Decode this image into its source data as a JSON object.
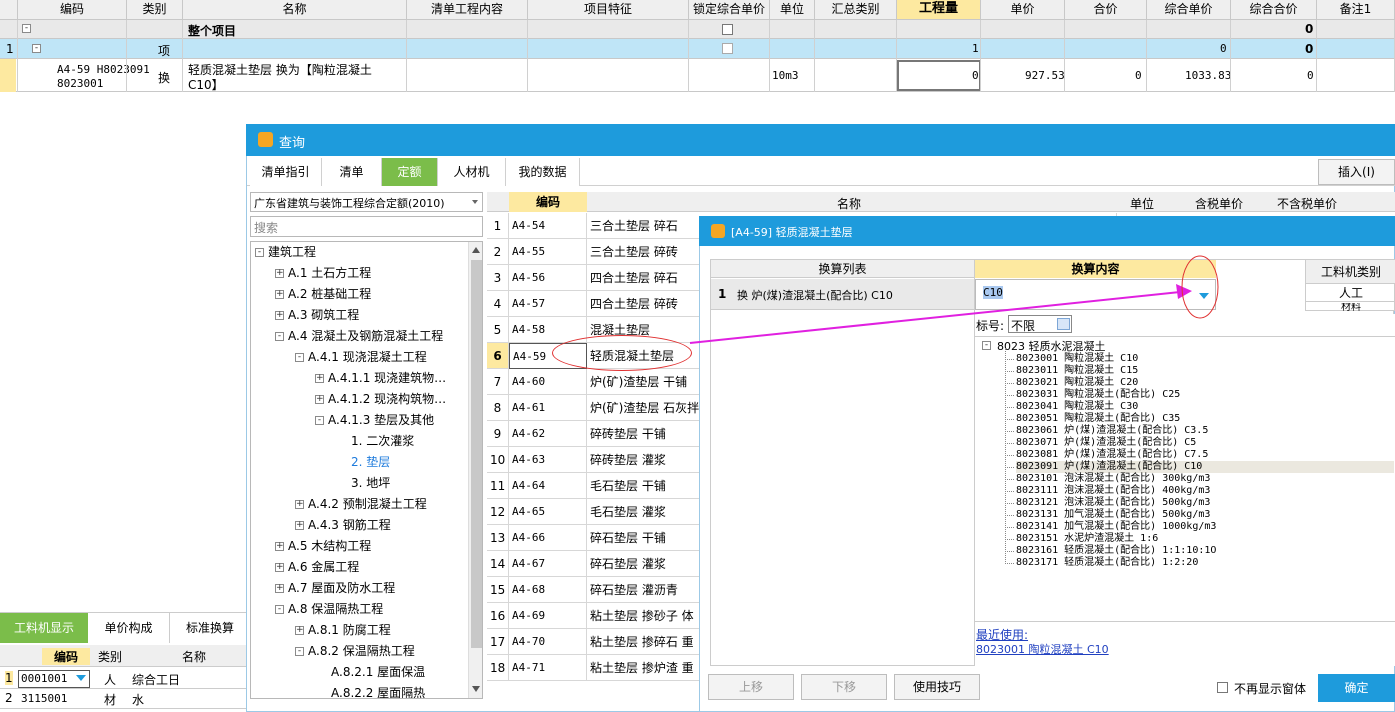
{
  "main_grid": {
    "headers": [
      "编码",
      "类别",
      "名称",
      "清单工程内容",
      "项目特征",
      "锁定综合单价",
      "单位",
      "汇总类别",
      "工程量",
      "单价",
      "合价",
      "综合单价",
      "综合合价",
      "备注1"
    ],
    "row0": {
      "name": "整个项目",
      "total": "0"
    },
    "row1": {
      "num": "1",
      "type": "项",
      "qty": "1",
      "total_unit": "0",
      "total": "0"
    },
    "row2": {
      "code_line1": "A4-59 H8023091",
      "code_line2": "8023001",
      "type": "换",
      "name_line1": "轻质混凝土垫层  换为【陶粒混凝土",
      "name_line2": "C10】",
      "unit": "10m3",
      "qty": "0",
      "price": "927.53",
      "amount": "0",
      "unit_total": "1033.83",
      "total": "0"
    }
  },
  "query_dialog": {
    "title": "查询",
    "tabs": [
      "清单指引",
      "清单",
      "定额",
      "人材机",
      "我的数据"
    ],
    "active_tab": "定额",
    "insert_button": "插入(I)",
    "norm_select": "广东省建筑与装饰工程综合定额(2010)",
    "search_placeholder": "搜索",
    "tree": [
      {
        "label": "建筑工程",
        "level": 0,
        "pm": "-"
      },
      {
        "label": "A.1 土石方工程",
        "level": 1,
        "pm": "+"
      },
      {
        "label": "A.2 桩基础工程",
        "level": 1,
        "pm": "+"
      },
      {
        "label": "A.3 砌筑工程",
        "level": 1,
        "pm": "+"
      },
      {
        "label": "A.4 混凝土及钢筋混凝土工程",
        "level": 1,
        "pm": "-"
      },
      {
        "label": "A.4.1 现浇混凝土工程",
        "level": 2,
        "pm": "-"
      },
      {
        "label": "A.4.1.1 现浇建筑物…",
        "level": 3,
        "pm": "+"
      },
      {
        "label": "A.4.1.2 现浇构筑物…",
        "level": 3,
        "pm": "+"
      },
      {
        "label": "A.4.1.3 垫层及其他",
        "level": 3,
        "pm": "-"
      },
      {
        "label": "1. 二次灌浆",
        "level": 4,
        "pm": ""
      },
      {
        "label": "2. 垫层",
        "level": 4,
        "pm": "",
        "selected": true
      },
      {
        "label": "3. 地坪",
        "level": 4,
        "pm": ""
      },
      {
        "label": "A.4.2 预制混凝土工程",
        "level": 2,
        "pm": "+"
      },
      {
        "label": "A.4.3 钢筋工程",
        "level": 2,
        "pm": "+"
      },
      {
        "label": "A.5 木结构工程",
        "level": 1,
        "pm": "+"
      },
      {
        "label": "A.6 金属工程",
        "level": 1,
        "pm": "+"
      },
      {
        "label": "A.7 屋面及防水工程",
        "level": 1,
        "pm": "+"
      },
      {
        "label": "A.8 保温隔热工程",
        "level": 1,
        "pm": "-"
      },
      {
        "label": "A.8.1 防腐工程",
        "level": 2,
        "pm": "+"
      },
      {
        "label": "A.8.2 保温隔热工程",
        "level": 2,
        "pm": "-"
      },
      {
        "label": "A.8.2.1 屋面保温",
        "level": 3,
        "pm": ""
      },
      {
        "label": "A.8.2.2 屋面隔热",
        "level": 3,
        "pm": ""
      }
    ],
    "list_headers": [
      "编码",
      "名称",
      "单位",
      "含税单价",
      "不含税单价"
    ],
    "list_rows": [
      {
        "n": "1",
        "code": "A4-54",
        "name": "三合土垫层 碎石"
      },
      {
        "n": "2",
        "code": "A4-55",
        "name": "三合土垫层 碎砖"
      },
      {
        "n": "3",
        "code": "A4-56",
        "name": "四合土垫层 碎石"
      },
      {
        "n": "4",
        "code": "A4-57",
        "name": "四合土垫层 碎砖"
      },
      {
        "n": "5",
        "code": "A4-58",
        "name": "混凝土垫层"
      },
      {
        "n": "6",
        "code": "A4-59",
        "name": "轻质混凝土垫层"
      },
      {
        "n": "7",
        "code": "A4-60",
        "name": "炉(矿)渣垫层 干铺"
      },
      {
        "n": "8",
        "code": "A4-61",
        "name": "炉(矿)渣垫层 石灰拌"
      },
      {
        "n": "9",
        "code": "A4-62",
        "name": "碎砖垫层 干铺"
      },
      {
        "n": "10",
        "code": "A4-63",
        "name": "碎砖垫层 灌浆"
      },
      {
        "n": "11",
        "code": "A4-64",
        "name": "毛石垫层 干铺"
      },
      {
        "n": "12",
        "code": "A4-65",
        "name": "毛石垫层 灌浆"
      },
      {
        "n": "13",
        "code": "A4-66",
        "name": "碎石垫层 干铺"
      },
      {
        "n": "14",
        "code": "A4-67",
        "name": "碎石垫层 灌浆"
      },
      {
        "n": "15",
        "code": "A4-68",
        "name": "碎石垫层 灌沥青"
      },
      {
        "n": "16",
        "code": "A4-69",
        "name": "粘土垫层 掺砂子 体"
      },
      {
        "n": "17",
        "code": "A4-70",
        "name": "粘土垫层 掺碎石 重"
      },
      {
        "n": "18",
        "code": "A4-71",
        "name": "粘土垫层 掺炉渣 重"
      }
    ]
  },
  "conv_dialog": {
    "title": "[A4-59] 轻质混凝土垫层",
    "list_header": "换算列表",
    "content_header": "换算内容",
    "row_num": "1",
    "row_label": "换 炉(煤)渣混凝土(配合比) C10",
    "value": "C10",
    "grade_label": "标号:",
    "grade_value": "不限",
    "category_header": "工料机类别",
    "category_items": [
      "人工",
      "材料"
    ],
    "tree_root": "8023 轻质水泥混凝土",
    "materials": [
      {
        "code": "8023001",
        "name": "陶粒混凝土 C10"
      },
      {
        "code": "8023011",
        "name": "陶粒混凝土 C15"
      },
      {
        "code": "8023021",
        "name": "陶粒混凝土 C20"
      },
      {
        "code": "8023031",
        "name": "陶粒混凝土(配合比) C25"
      },
      {
        "code": "8023041",
        "name": "陶粒混凝土 C30"
      },
      {
        "code": "8023051",
        "name": "陶粒混凝土(配合比) C35"
      },
      {
        "code": "8023061",
        "name": "炉(煤)渣混凝土(配合比) C3.5"
      },
      {
        "code": "8023071",
        "name": "炉(煤)渣混凝土(配合比) C5"
      },
      {
        "code": "8023081",
        "name": "炉(煤)渣混凝土(配合比) C7.5"
      },
      {
        "code": "8023091",
        "name": "炉(煤)渣混凝土(配合比) C10",
        "selected": true
      },
      {
        "code": "8023101",
        "name": "泡沫混凝土(配合比) 300kg/m3"
      },
      {
        "code": "8023111",
        "name": "泡沫混凝土(配合比) 400kg/m3"
      },
      {
        "code": "8023121",
        "name": "泡沫混凝土(配合比) 500kg/m3"
      },
      {
        "code": "8023131",
        "name": "加气混凝土(配合比) 500kg/m3"
      },
      {
        "code": "8023141",
        "name": "加气混凝土(配合比) 1000kg/m3"
      },
      {
        "code": "8023151",
        "name": "水泥炉渣混凝土 1:6"
      },
      {
        "code": "8023161",
        "name": "轻质混凝土(配合比) 1:1:10:1O"
      },
      {
        "code": "8023171",
        "name": "轻质混凝土(配合比) 1:2:20"
      }
    ],
    "recent_label": "最近使用:",
    "recent_item": "8023001 陶粒混凝土 C10",
    "btn_up": "上移",
    "btn_down": "下移",
    "btn_tips": "使用技巧",
    "no_show_label": "不再显示窗体",
    "confirm": "确定"
  },
  "bottom_panel": {
    "tabs": [
      "工料机显示",
      "单价构成",
      "标准换算"
    ],
    "headers": [
      "编码",
      "类别",
      "名称"
    ],
    "rows": [
      {
        "n": "1",
        "code": "0001001",
        "type": "人",
        "name": "综合工日"
      },
      {
        "n": "2",
        "code": "3115001",
        "type": "材",
        "name": "水"
      }
    ]
  },
  "colors": {
    "accent_green": "#7bbd4a",
    "title_blue": "#1e9bdc",
    "highlight_yellow": "#fde9a0",
    "arrow": "#e020e0"
  }
}
